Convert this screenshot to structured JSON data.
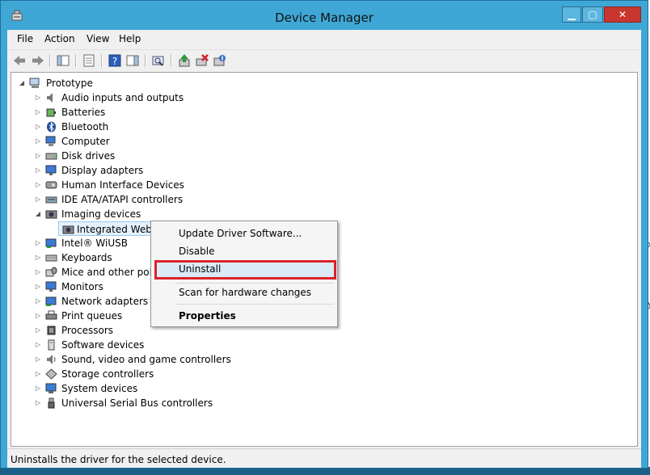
{
  "window": {
    "title": "Device Manager",
    "controls": {
      "minimize": "▁",
      "maximize": "▢",
      "close": "✕"
    }
  },
  "menu": [
    "File",
    "Action",
    "View",
    "Help"
  ],
  "toolbar": [
    "back-icon",
    "forward-icon",
    "show-hide-tree-icon",
    "properties-icon",
    "help-icon",
    "action-pane-icon",
    "scan-hardware-icon",
    "update-driver-icon",
    "uninstall-icon",
    "disable-icon"
  ],
  "tree": {
    "root": "Prototype",
    "items": [
      {
        "label": "Audio inputs and outputs",
        "icon": "speaker-icon",
        "state": "collapsed"
      },
      {
        "label": "Batteries",
        "icon": "battery-icon",
        "state": "collapsed"
      },
      {
        "label": "Bluetooth",
        "icon": "bluetooth-icon",
        "state": "collapsed"
      },
      {
        "label": "Computer",
        "icon": "computer-icon",
        "state": "collapsed"
      },
      {
        "label": "Disk drives",
        "icon": "disk-icon",
        "state": "collapsed"
      },
      {
        "label": "Display adapters",
        "icon": "monitor-icon",
        "state": "collapsed"
      },
      {
        "label": "Human Interface Devices",
        "icon": "hid-icon",
        "state": "collapsed"
      },
      {
        "label": "IDE ATA/ATAPI controllers",
        "icon": "ide-icon",
        "state": "collapsed"
      },
      {
        "label": "Imaging devices",
        "icon": "camera-icon",
        "state": "expanded"
      },
      {
        "label": "Integrated Webca",
        "icon": "webcam-icon",
        "state": "child"
      },
      {
        "label": "Intel® WiUSB",
        "icon": "usb-network-icon",
        "state": "collapsed"
      },
      {
        "label": "Keyboards",
        "icon": "keyboard-icon",
        "state": "collapsed"
      },
      {
        "label": "Mice and other point",
        "icon": "mouse-icon",
        "state": "collapsed"
      },
      {
        "label": "Monitors",
        "icon": "monitor-icon",
        "state": "collapsed"
      },
      {
        "label": "Network adapters",
        "icon": "network-icon",
        "state": "collapsed"
      },
      {
        "label": "Print queues",
        "icon": "printer-icon",
        "state": "collapsed"
      },
      {
        "label": "Processors",
        "icon": "processor-icon",
        "state": "collapsed"
      },
      {
        "label": "Software devices",
        "icon": "software-icon",
        "state": "collapsed"
      },
      {
        "label": "Sound, video and game controllers",
        "icon": "sound-icon",
        "state": "collapsed"
      },
      {
        "label": "Storage controllers",
        "icon": "storage-icon",
        "state": "collapsed"
      },
      {
        "label": "System devices",
        "icon": "system-icon",
        "state": "collapsed"
      },
      {
        "label": "Universal Serial Bus controllers",
        "icon": "usb-icon",
        "state": "collapsed"
      }
    ]
  },
  "context_menu": {
    "update": "Update Driver Software...",
    "disable": "Disable",
    "uninstall": "Uninstall",
    "scan": "Scan for hardware changes",
    "properties": "Properties"
  },
  "status": "Uninstalls the driver for the selected device.",
  "colors": {
    "titlebar": "#3fa7d6",
    "close": "#c7372f",
    "highlight": "#d9232a"
  }
}
